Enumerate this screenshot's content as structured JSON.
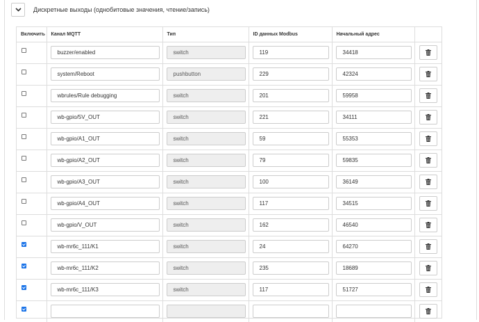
{
  "section": {
    "title": "Дискретные выходы (однобитовые значения, чтение/запись)",
    "toggle_icon": "chevron-down-icon"
  },
  "table": {
    "headers": {
      "enable": "Включить",
      "mqtt": "Канал MQTT",
      "type": "Тип",
      "modbus_id": "ID данных Modbus",
      "start_address": "Начальный адрес"
    },
    "delete_icon": "trash-icon",
    "rows": [
      {
        "enabled": false,
        "mqtt": "buzzer/enabled",
        "type": "switch",
        "modbus_id": "119",
        "start_address": "34418"
      },
      {
        "enabled": false,
        "mqtt": "system/Reboot",
        "type": "pushbutton",
        "modbus_id": "229",
        "start_address": "42324"
      },
      {
        "enabled": false,
        "mqtt": "wbrules/Rule debugging",
        "type": "switch",
        "modbus_id": "201",
        "start_address": "59958"
      },
      {
        "enabled": false,
        "mqtt": "wb-gpio/5V_OUT",
        "type": "switch",
        "modbus_id": "221",
        "start_address": "34111"
      },
      {
        "enabled": false,
        "mqtt": "wb-gpio/A1_OUT",
        "type": "switch",
        "modbus_id": "59",
        "start_address": "55353"
      },
      {
        "enabled": false,
        "mqtt": "wb-gpio/A2_OUT",
        "type": "switch",
        "modbus_id": "79",
        "start_address": "59835"
      },
      {
        "enabled": false,
        "mqtt": "wb-gpio/A3_OUT",
        "type": "switch",
        "modbus_id": "100",
        "start_address": "36149"
      },
      {
        "enabled": false,
        "mqtt": "wb-gpio/A4_OUT",
        "type": "switch",
        "modbus_id": "117",
        "start_address": "34515"
      },
      {
        "enabled": false,
        "mqtt": "wb-gpio/V_OUT",
        "type": "switch",
        "modbus_id": "162",
        "start_address": "46540"
      },
      {
        "enabled": true,
        "mqtt": "wb-mr6c_111/K1",
        "type": "switch",
        "modbus_id": "24",
        "start_address": "64270"
      },
      {
        "enabled": true,
        "mqtt": "wb-mr6c_111/K2",
        "type": "switch",
        "modbus_id": "235",
        "start_address": "18689"
      },
      {
        "enabled": true,
        "mqtt": "wb-mr6c_111/K3",
        "type": "switch",
        "modbus_id": "117",
        "start_address": "51727"
      },
      {
        "enabled": true,
        "mqtt": "",
        "type": "",
        "modbus_id": "",
        "start_address": ""
      }
    ]
  }
}
